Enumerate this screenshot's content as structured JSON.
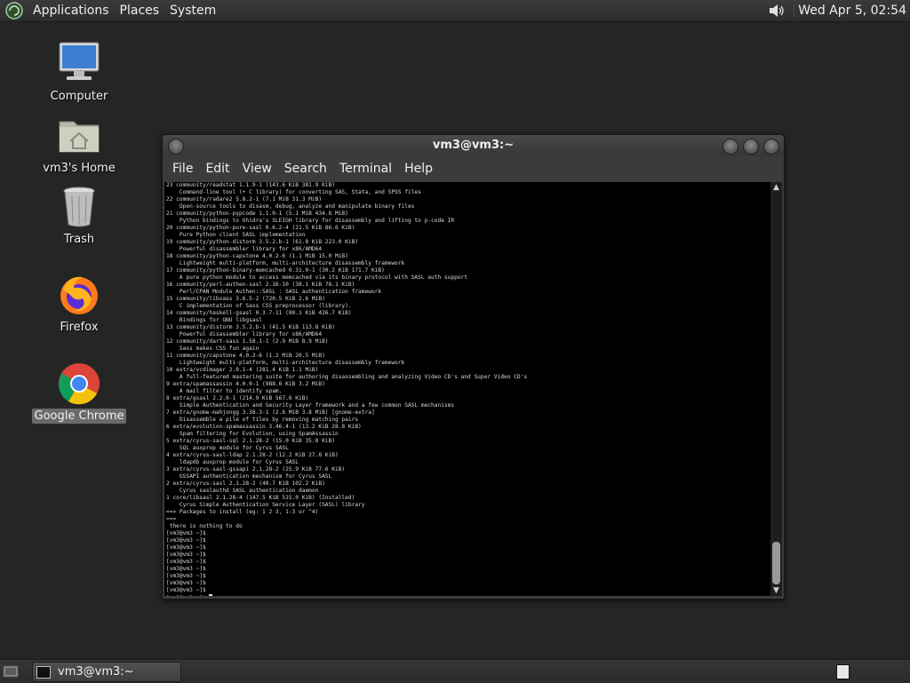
{
  "top_panel": {
    "menus": [
      "Applications",
      "Places",
      "System"
    ],
    "clock": "Wed Apr  5, 02:54"
  },
  "desktop_icons": [
    {
      "label": "Computer",
      "icon": "computer-icon"
    },
    {
      "label": "vm3's Home",
      "icon": "home-folder-icon"
    },
    {
      "label": "Trash",
      "icon": "trash-icon"
    },
    {
      "label": "Firefox",
      "icon": "firefox-icon"
    },
    {
      "label": "Google Chrome",
      "icon": "chrome-icon",
      "selected": true
    }
  ],
  "window": {
    "title": "vm3@vm3:~",
    "menus": [
      "File",
      "Edit",
      "View",
      "Search",
      "Terminal",
      "Help"
    ]
  },
  "terminal_lines": [
    "23 community/readstat 1.1.9-1 (143.6 KiB 381.9 KiB)",
    "    Command-line tool (+ C library) for converting SAS, Stata, and SPSS files",
    "22 community/radare2 5.8.2-1 (7.1 MiB 31.3 MiB)",
    "    Open-source tools to disasm, debug, analyze and manipulate binary files",
    "21 community/python-pypcode 1.1.0-1 (5.1 MiB 434.8 MiB)",
    "    Python bindings to Ghidra's SLEIGH library for disassembly and lifting to p-code IR",
    "20 community/python-pure-sasl 0.6.2-4 (21.5 KiB 86.6 KiB)",
    "    Pure Python client SASL implementation",
    "19 community/python-distorm 3.5.2.b-1 (61.8 KiB 223.0 KiB)",
    "    Powerful disassembler library for x86/AMD64",
    "18 community/python-capstone 4.0.2-6 (1.1 MiB 15.0 MiB)",
    "    Lightweight multi-platform, multi-architecture disassembly framework",
    "17 community/python-binary-memcached 0.31.0-1 (30.2 KiB 171.7 KiB)",
    "    A pure python module to access memcached via its binary protocol with SASL auth support",
    "16 community/perl-authen-sasl 2.16-10 (38.1 KiB 78.1 KiB)",
    "    Perl/CPAN Module Authen::SASL : SASL authentication framework",
    "15 community/libsass 3.6.5-2 (720.5 KiB 2.6 MiB)",
    "    C implementation of Sass CSS preprocessor (library).",
    "14 community/haskell-gsasl 0.3.7-11 (80.1 KiB 426.7 KiB)",
    "    Bindings for GNU libgsasl",
    "13 community/distorm 3.5.2.b-1 (41.5 KiB 113.8 KiB)",
    "    Powerful disassembler library for x86/AMD64",
    "12 community/dart-sass 1.58.1-1 (2.9 MiB 8.9 MiB)",
    "    Sass makes CSS fun again",
    "11 community/capstone 4.0.2-6 (1.2 MiB 20.5 MiB)",
    "    Lightweight multi-platform, multi-architecture disassembly framework",
    "10 extra/vcdimager 2.0.1-4 (281.4 KiB 1.1 MiB)",
    "    A full-featured mastering suite for authoring disassembling and analyzing Video CD's and Super Video CD's",
    "9 extra/spamassassin 4.0.0-1 (988.6 KiB 3.2 MiB)",
    "    A mail filter to identify spam.",
    "8 extra/gsasl 2.2.0-1 (214.9 KiB 567.6 KiB)",
    "    Simple Authentication and Security Layer framework and a few common SASL mechanisms",
    "7 extra/gnome-mahjongg 3.38.3-1 (2.6 MiB 3.8 MiB) [gnome-extra]",
    "    Disassemble a pile of tiles by removing matching pairs",
    "6 extra/evolution-spamassassin 3.46.4-1 (13.2 KiB 28.8 KiB)",
    "    Spam filtering for Evolution, using SpamAssassin",
    "5 extra/cyrus-sasl-sql 2.1.28-2 (15.0 KiB 35.8 KiB)",
    "    SQL auxprop module for Cyrus SASL",
    "4 extra/cyrus-sasl-ldap 2.1.28-2 (12.2 KiB 27.8 KiB)",
    "    ldapdb auxprop module for Cyrus SASL",
    "3 extra/cyrus-sasl-gssapi 2.1.28-2 (25.9 KiB 77.6 KiB)",
    "    GSSAPI authentication mechanism for Cyrus SASL",
    "2 extra/cyrus-sasl 2.1.28-2 (40.7 KiB 102.2 KiB)",
    "    Cyrus saslauthd SASL authentication daemon",
    "1 core/libsasl 2.1.28-4 (147.5 KiB 515.0 KiB) (Installed)",
    "    Cyrus Simple Authentication Service Layer (SASL) library",
    "==> Packages to install (eg: 1 2 3, 1-3 or ^4)",
    "==>",
    " there is nothing to do",
    "[vm3@vm3 ~]$",
    "[vm3@vm3 ~]$",
    "[vm3@vm3 ~]$",
    "[vm3@vm3 ~]$",
    "[vm3@vm3 ~]$",
    "[vm3@vm3 ~]$",
    "[vm3@vm3 ~]$",
    "[vm3@vm3 ~]$",
    "[vm3@vm3 ~]$",
    "[vm3@vm3 ~]$"
  ],
  "taskbar": {
    "task_label": "vm3@vm3:~"
  }
}
